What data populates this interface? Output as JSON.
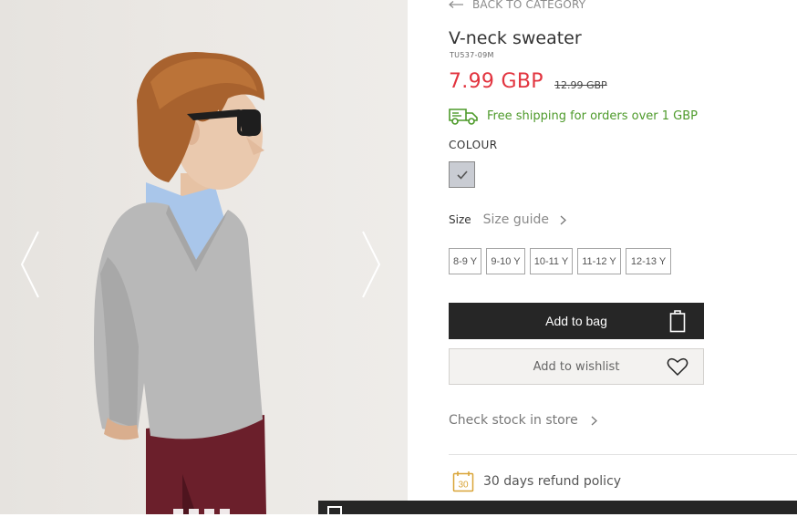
{
  "navigation": {
    "back_label": "BACK TO CATEGORY"
  },
  "product": {
    "title": "V-neck sweater",
    "sku": "TU537-09M",
    "price": "7.99 GBP",
    "old_price": "12.99 GBP",
    "shipping_text": "Free shipping for orders over 1 GBP",
    "colour_label": "COLOUR",
    "size_label": "Size",
    "size_guide_label": "Size guide",
    "sizes": [
      "8-9 Y",
      "9-10 Y",
      "10-11 Y",
      "11-12 Y",
      "12-13 Y"
    ],
    "add_to_bag_label": "Add to bag",
    "wishlist_label": "Add to wishlist",
    "stock_label": "Check stock in store",
    "refund_label": "30 days refund policy",
    "refund_icon_number": "30"
  },
  "colors": {
    "accent_price": "#e2343f",
    "shipping_green": "#4d9a2a",
    "refund_gold": "#d9a437",
    "button_dark": "#262626"
  },
  "icons": {
    "back": "arrow-left-icon",
    "shipping": "delivery-truck-icon",
    "bag": "shopping-bag-icon",
    "wishlist": "heart-icon",
    "refund": "calendar-icon"
  }
}
